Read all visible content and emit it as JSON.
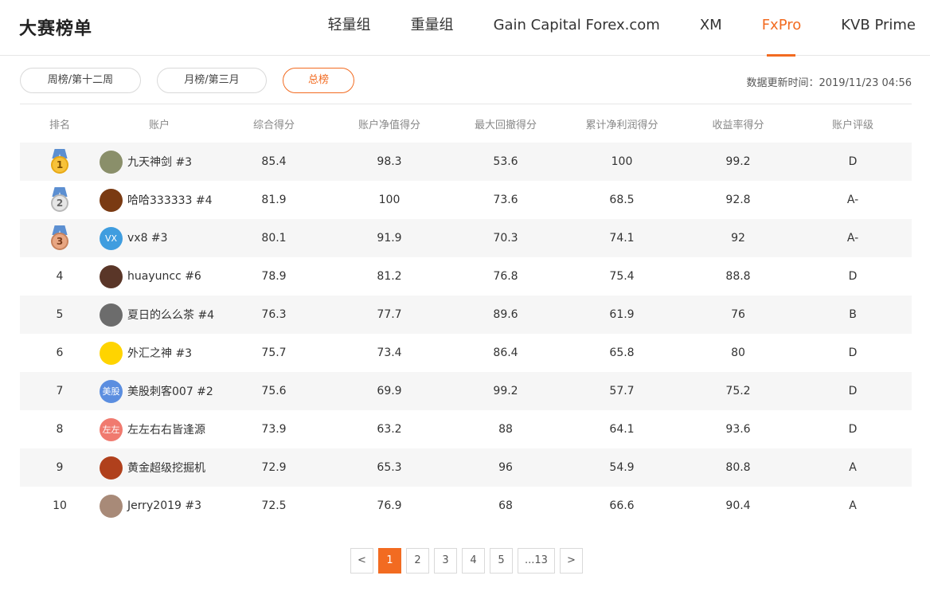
{
  "header": {
    "title": "大赛榜单",
    "tabs": [
      {
        "label": "轻量组",
        "active": false
      },
      {
        "label": "重量组",
        "active": false
      },
      {
        "label": "Gain Capital Forex.com",
        "active": false
      },
      {
        "label": "XM",
        "active": false
      },
      {
        "label": "FxPro",
        "active": true
      },
      {
        "label": "KVB Prime",
        "active": false
      }
    ]
  },
  "filters": {
    "weekly": "周榜/第十二周",
    "monthly": "月榜/第三月",
    "overall": "总榜",
    "active": "overall"
  },
  "update_time": "数据更新时间：2019/11/23 04:56",
  "table": {
    "headers": [
      "排名",
      "账户",
      "综合得分",
      "账户净值得分",
      "最大回撤得分",
      "累计净利润得分",
      "收益率得分",
      "账户评级"
    ],
    "rows": [
      {
        "rank": "1",
        "medal": "gold",
        "name": "九天神剑 #3",
        "avatar_color": "#8a8f6a",
        "avatar_text": "",
        "s1": "85.4",
        "s2": "98.3",
        "s3": "53.6",
        "s4": "100",
        "s5": "99.2",
        "rating": "D"
      },
      {
        "rank": "2",
        "medal": "silver",
        "name": "哈哈333333 #4",
        "avatar_color": "#7a3a12",
        "avatar_text": "",
        "s1": "81.9",
        "s2": "100",
        "s3": "73.6",
        "s4": "68.5",
        "s5": "92.8",
        "rating": "A-"
      },
      {
        "rank": "3",
        "medal": "bronze",
        "name": "vx8 #3",
        "avatar_color": "#3f9ddf",
        "avatar_text": "VX",
        "s1": "80.1",
        "s2": "91.9",
        "s3": "70.3",
        "s4": "74.1",
        "s5": "92",
        "rating": "A-"
      },
      {
        "rank": "4",
        "medal": "",
        "name": "huayuncc #6",
        "avatar_color": "#5a3628",
        "avatar_text": "",
        "s1": "78.9",
        "s2": "81.2",
        "s3": "76.8",
        "s4": "75.4",
        "s5": "88.8",
        "rating": "D"
      },
      {
        "rank": "5",
        "medal": "",
        "name": "夏日的么么茶 #4",
        "avatar_color": "#6c6c6c",
        "avatar_text": "",
        "s1": "76.3",
        "s2": "77.7",
        "s3": "89.6",
        "s4": "61.9",
        "s5": "76",
        "rating": "B"
      },
      {
        "rank": "6",
        "medal": "",
        "name": "外汇之神 #3",
        "avatar_color": "#ffd400",
        "avatar_text": "",
        "s1": "75.7",
        "s2": "73.4",
        "s3": "86.4",
        "s4": "65.8",
        "s5": "80",
        "rating": "D"
      },
      {
        "rank": "7",
        "medal": "",
        "name": "美股刺客007 #2",
        "avatar_color": "#5b8ee0",
        "avatar_text": "美股",
        "s1": "75.6",
        "s2": "69.9",
        "s3": "99.2",
        "s4": "57.7",
        "s5": "75.2",
        "rating": "D"
      },
      {
        "rank": "8",
        "medal": "",
        "name": "左左右右皆逢源",
        "avatar_color": "#f07a6f",
        "avatar_text": "左左",
        "s1": "73.9",
        "s2": "63.2",
        "s3": "88",
        "s4": "64.1",
        "s5": "93.6",
        "rating": "D"
      },
      {
        "rank": "9",
        "medal": "",
        "name": "黄金超级挖掘机",
        "avatar_color": "#b0401c",
        "avatar_text": "",
        "s1": "72.9",
        "s2": "65.3",
        "s3": "96",
        "s4": "54.9",
        "s5": "80.8",
        "rating": "A"
      },
      {
        "rank": "10",
        "medal": "",
        "name": "Jerry2019 #3",
        "avatar_color": "#a88a78",
        "avatar_text": "",
        "s1": "72.5",
        "s2": "76.9",
        "s3": "68",
        "s4": "66.6",
        "s5": "90.4",
        "rating": "A"
      }
    ]
  },
  "pagination": {
    "prev": "<",
    "pages": [
      "1",
      "2",
      "3",
      "4",
      "5",
      "...13"
    ],
    "next": ">",
    "current": "1"
  },
  "colors": {
    "accent": "#f26b21",
    "row_alt": "#f6f6f6"
  }
}
